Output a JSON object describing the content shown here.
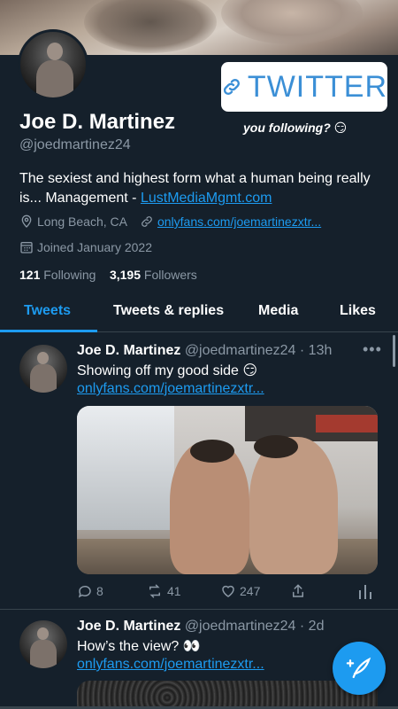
{
  "profile": {
    "name": "Joe D. Martinez",
    "handle": "@joedmartinez24",
    "bio_text": "The sexiest and highest form what a human being really is... Management - ",
    "bio_link": "LustMediaMgmt.com",
    "location": "Long Beach, CA",
    "website": "onlyfans.com/joemartinezxtr...",
    "joined": "Joined January 2022",
    "following_count": "121",
    "following_label": "Following",
    "followers_count": "3,195",
    "followers_label": "Followers"
  },
  "sticker": {
    "label": "TWITTER",
    "caption": "you following? 😏"
  },
  "tabs": [
    {
      "label": "Tweets",
      "active": true
    },
    {
      "label": "Tweets & replies",
      "active": false
    },
    {
      "label": "Media",
      "active": false
    },
    {
      "label": "Likes",
      "active": false
    }
  ],
  "tweets": [
    {
      "name": "Joe D. Martinez",
      "handle_time": "@joedmartinez24 · 13h",
      "text": "Showing off my good side 😏",
      "link": "onlyfans.com/joemartinezxtr...",
      "replies": "8",
      "retweets": "41",
      "likes": "247"
    },
    {
      "name": "Joe D. Martinez",
      "handle_time": "@joedmartinez24 · 2d",
      "text": "How’s the view? 👀",
      "link": "onlyfans.com/joemartinezxtr..."
    }
  ],
  "icons": {
    "link": "link-icon",
    "location": "location-pin-icon",
    "website": "link-icon",
    "calendar": "calendar-icon",
    "more": "more-dots-icon",
    "reply": "reply-icon",
    "retweet": "retweet-icon",
    "like": "heart-icon",
    "share": "share-icon",
    "analytics": "analytics-icon",
    "compose": "compose-icon"
  },
  "colors": {
    "background": "#15202b",
    "accent": "#1d9bf0",
    "muted": "#8b98a5",
    "divider": "#38444d"
  }
}
